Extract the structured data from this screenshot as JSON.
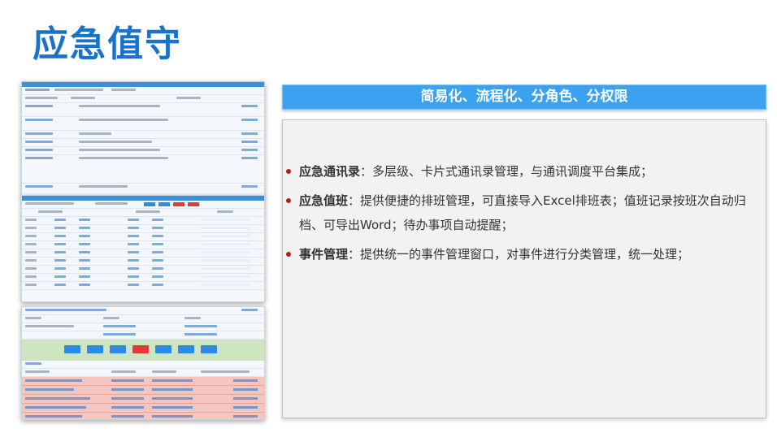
{
  "title": "应急值守",
  "banner": "简易化、流程化、分角色、分权限",
  "features": [
    {
      "label": "应急通讯录",
      "sep": "：",
      "desc": "多层级、卡片式通讯录管理，与通讯调度平台集成；"
    },
    {
      "label": "应急值班",
      "sep": "：",
      "desc": "提供便捷的排班管理，可直接导入Excel排班表；值班记录按班次自动归档、可导出Word；待办事项自动提醒；"
    },
    {
      "label": "事件管理",
      "sep": "：",
      "desc": "提供统一的事件管理窗口，对事件进行分类管理，统一处理；"
    }
  ],
  "colors": {
    "title": "#1a73c7",
    "banner": "#3aa2f0",
    "bullet": "#b71c1c"
  }
}
